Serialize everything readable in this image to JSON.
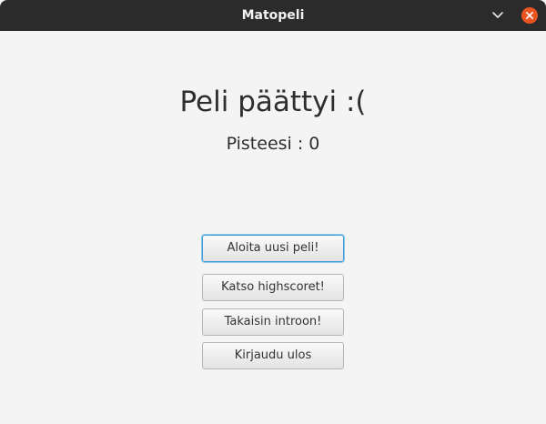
{
  "window": {
    "title": "Matopeli"
  },
  "main": {
    "heading": "Peli päättyi :(",
    "score_text": "Pisteesi : 0"
  },
  "buttons": {
    "new_game": "Aloita uusi peli!",
    "highscores": "Katso highscoret!",
    "back_to_intro": "Takaisin introon!",
    "logout": "Kirjaudu ulos"
  },
  "icons": {
    "minimize": "chevron-down-icon",
    "close": "close-icon"
  },
  "colors": {
    "titlebar": "#2b2b2b",
    "close_accent": "#e95420",
    "focus_ring": "#3b9bd8",
    "background": "#f4f4f4"
  }
}
